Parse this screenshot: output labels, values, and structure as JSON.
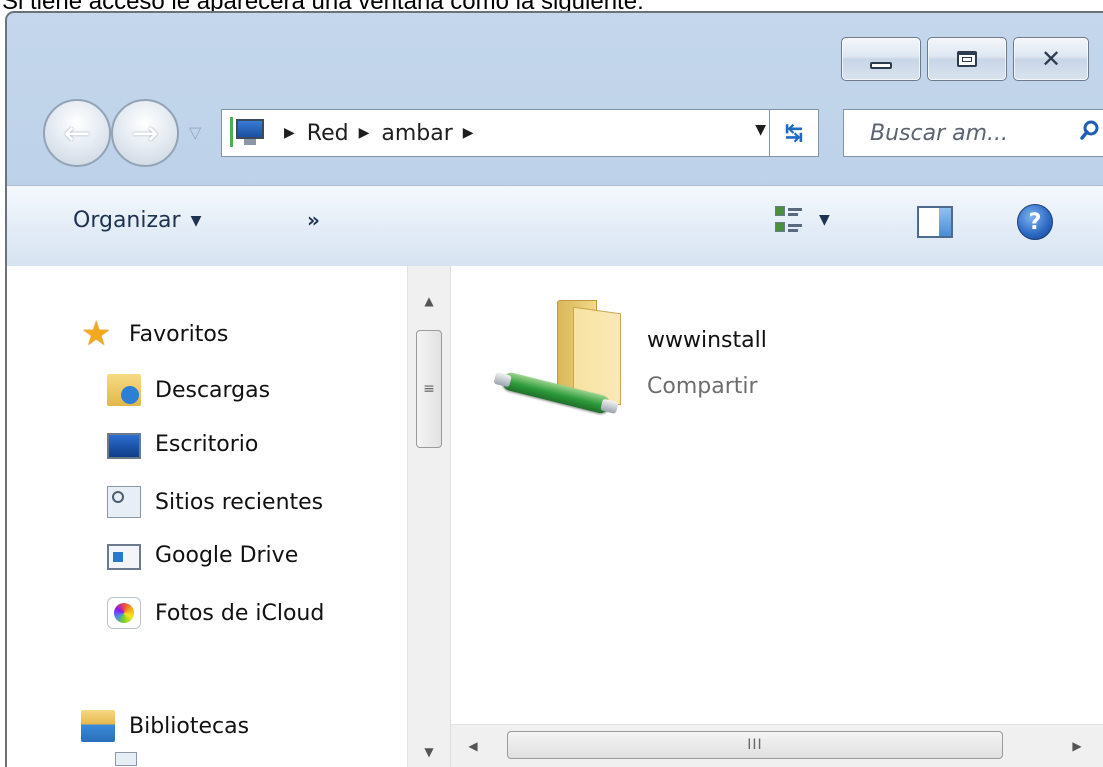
{
  "caption": "Si tiene acceso le aparecerá una ventana como la siguiente:",
  "window": {
    "caption_buttons": {
      "minimize_icon": "minimize-icon",
      "maximize_icon": "maximize-icon",
      "close_glyph": "✕"
    }
  },
  "navigation": {
    "back_icon": "back-arrow-icon",
    "forward_icon": "forward-arrow-icon",
    "back_glyph": "←",
    "forward_glyph": "→",
    "history_glyph": "▽",
    "address": {
      "icon": "network-computer-icon",
      "breadcrumbs": [
        "Red",
        "ambar"
      ],
      "separator": "▶",
      "dropdown_glyph": "▼",
      "refresh_glyph": "↹"
    },
    "search": {
      "placeholder": "Buscar am...",
      "icon": "search-icon"
    }
  },
  "command_bar": {
    "organize_label": "Organizar",
    "dropdown_glyph": "▼",
    "more_label": "»",
    "views_icon": "views-icon",
    "preview_pane_icon": "preview-pane-icon",
    "help_glyph": "?"
  },
  "nav_pane": {
    "groups": [
      {
        "label": "Favoritos",
        "icon": "star-icon",
        "items": [
          {
            "label": "Descargas",
            "icon": "downloads-folder-icon"
          },
          {
            "label": "Escritorio",
            "icon": "desktop-icon"
          },
          {
            "label": "Sitios recientes",
            "icon": "recent-places-icon"
          },
          {
            "label": "Google Drive",
            "icon": "google-drive-icon"
          },
          {
            "label": "Fotos de iCloud",
            "icon": "icloud-photos-icon"
          }
        ]
      },
      {
        "label": "Bibliotecas",
        "icon": "libraries-icon",
        "items": []
      }
    ],
    "scrollbar": {
      "thumb_grip": "≡",
      "up_glyph": "▲",
      "down_glyph": "▼"
    }
  },
  "main_pane": {
    "items": [
      {
        "name": "wwwinstall",
        "type": "Compartir",
        "icon": "network-share-folder-icon"
      }
    ],
    "h_scrollbar": {
      "thumb_grip": "III",
      "left_glyph": "◀",
      "right_glyph": "▶"
    }
  }
}
